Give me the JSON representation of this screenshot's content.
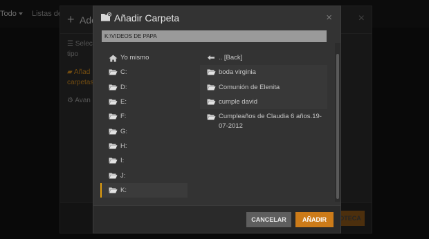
{
  "background": {
    "tabs": [
      "Todo",
      "Listas de"
    ],
    "modal_title": "Ado",
    "lines": [
      "Selec",
      "tipo",
      "Añad",
      "carpetas",
      "Avan"
    ],
    "footer_button": "OTECA"
  },
  "dialog": {
    "title": "Añadir Carpeta",
    "close_icon": "×",
    "path_value": "K:\\VIDEOS DE PAPA",
    "left_items": [
      {
        "label": "Yo mismo",
        "icon": "home-icon"
      },
      {
        "label": "C:",
        "icon": "folder-open-icon"
      },
      {
        "label": "D:",
        "icon": "folder-open-icon"
      },
      {
        "label": "E:",
        "icon": "folder-open-icon"
      },
      {
        "label": "F:",
        "icon": "folder-open-icon"
      },
      {
        "label": "G:",
        "icon": "folder-open-icon"
      },
      {
        "label": "H:",
        "icon": "folder-open-icon"
      },
      {
        "label": "I:",
        "icon": "folder-open-icon"
      },
      {
        "label": "J:",
        "icon": "folder-open-icon"
      },
      {
        "label": "K:",
        "icon": "folder-open-icon",
        "selected": true
      }
    ],
    "right_items": [
      {
        "label": ".. [Back]",
        "icon": "arrow-left-icon"
      },
      {
        "label": "boda virginia",
        "icon": "folder-open-icon"
      },
      {
        "label": "Comunión de Elenita",
        "icon": "folder-open-icon"
      },
      {
        "label": "cumple david",
        "icon": "folder-open-icon"
      },
      {
        "label": "Cumpleaños de Claudia 6 años.19-07-2012",
        "icon": "folder-open-icon"
      }
    ],
    "cancel_label": "CANCELAR",
    "add_label": "AÑADIR"
  },
  "colors": {
    "accent": "#cc7b19",
    "selected_bar": "#e5a00d",
    "dialog_bg": "#333333"
  }
}
